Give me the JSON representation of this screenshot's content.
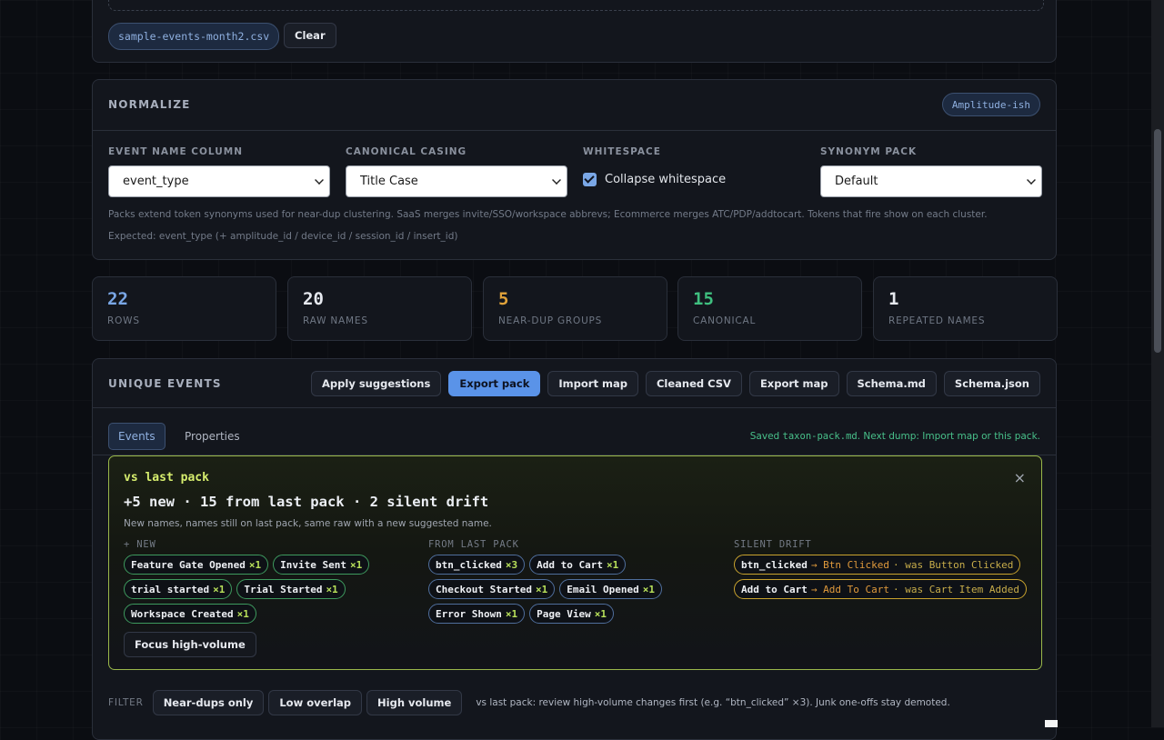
{
  "upload": {
    "file_name": "sample-events-month2.csv",
    "clear_label": "Clear"
  },
  "normalize": {
    "title": "NORMALIZE",
    "preset_badge": "Amplitude-ish",
    "fields": {
      "event_name_column": {
        "label": "EVENT NAME COLUMN",
        "value": "event_type"
      },
      "canonical_casing": {
        "label": "CANONICAL CASING",
        "value": "Title Case"
      },
      "whitespace": {
        "label": "WHITESPACE",
        "checkbox_label": "Collapse whitespace",
        "checked": true
      },
      "synonym_pack": {
        "label": "SYNONYM PACK",
        "value": "Default"
      }
    },
    "hint_packs": "Packs extend token synonyms used for near-dup clustering. SaaS merges invite/SSO/workspace abbrevs; Ecommerce merges ATC/PDP/addtocart. Tokens that fire show on each cluster.",
    "hint_expected": "Expected: event_type (+ amplitude_id / device_id / session_id / insert_id)"
  },
  "stats": [
    {
      "value": "22",
      "label": "ROWS",
      "color": "#7aa7e6"
    },
    {
      "value": "20",
      "label": "RAW NAMES",
      "color": "#e6e9ef"
    },
    {
      "value": "5",
      "label": "NEAR-DUP GROUPS",
      "color": "#e0a23a"
    },
    {
      "value": "15",
      "label": "CANONICAL",
      "color": "#3fbf7f"
    },
    {
      "value": "1",
      "label": "REPEATED NAMES",
      "color": "#e6e9ef"
    }
  ],
  "events": {
    "title": "UNIQUE EVENTS",
    "toolbar": [
      "Apply suggestions",
      "Export pack",
      "Import map",
      "Cleaned CSV",
      "Export map",
      "Schema.md",
      "Schema.json"
    ],
    "tabs": [
      "Events",
      "Properties"
    ],
    "saved_prefix": "Saved ",
    "saved_file": "taxon-pack.md",
    "saved_suffix": ". Next dump: Import map or this pack.",
    "drift": {
      "title": "vs last pack",
      "close": "×",
      "summary": "+5 new · 15 from last pack · 2 silent drift",
      "description": "New names, names still on last pack, same raw with a new suggested name.",
      "col_new": "+ NEW",
      "col_last": "FROM LAST PACK",
      "col_drift": "SILENT DRIFT",
      "new_items": [
        {
          "name": "Feature Gate Opened",
          "count": "×1"
        },
        {
          "name": "Invite Sent",
          "count": "×1"
        },
        {
          "name": "trial started",
          "count": "×1"
        },
        {
          "name": "Trial Started",
          "count": "×1"
        },
        {
          "name": "Workspace Created",
          "count": "×1"
        }
      ],
      "last_items": [
        {
          "name": "btn_clicked",
          "count": "×3"
        },
        {
          "name": "Add to Cart",
          "count": "×1"
        },
        {
          "name": "Checkout Started",
          "count": "×1"
        },
        {
          "name": "Email Opened",
          "count": "×1"
        },
        {
          "name": "Error Shown",
          "count": "×1"
        },
        {
          "name": "Page View",
          "count": "×1"
        }
      ],
      "drift_items": [
        {
          "raw": "btn_clicked",
          "to": "→ Btn Clicked",
          "was": "· was Button Clicked"
        },
        {
          "raw": "Add to Cart",
          "to": "→ Add To Cart",
          "was": "· was Cart Item Added"
        }
      ],
      "focus_label": "Focus high-volume"
    },
    "filter": {
      "label": "FILTER",
      "buttons": [
        "Near-dups only",
        "Low overlap",
        "High volume"
      ],
      "note": "vs last pack: review high-volume changes first (e.g. “btn_clicked” ×3). Junk one-offs stay demoted."
    }
  }
}
